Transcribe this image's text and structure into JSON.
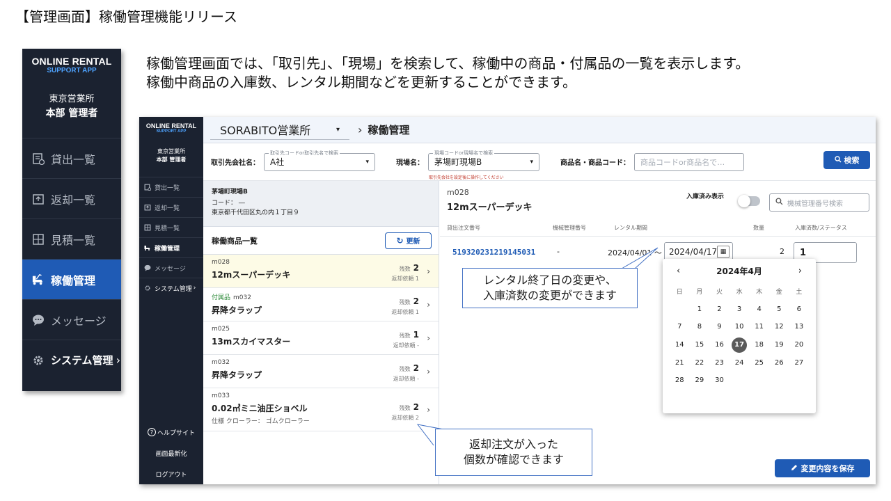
{
  "slide": {
    "title": "【管理画面】稼働管理機能リリース",
    "desc1": "稼働管理画面では、「取引先」、「現場」を検索して、稼働中の商品・付属品の一覧を表示します。",
    "desc2": "稼働中商品の入庫数、レンタル期間などを更新することができます。"
  },
  "big_sidebar": {
    "logo1": "ONLINE RENTAL",
    "logo2": "SUPPORT APP",
    "office": "東京営業所",
    "role": "本部 管理者",
    "items": [
      "貸出一覧",
      "返却一覧",
      "見積一覧",
      "稼働管理",
      "メッセージ",
      "システム管理"
    ]
  },
  "app": {
    "sidebar": {
      "logo1": "ONLINE RENTAL",
      "logo2": "SUPPORT APP",
      "office": "東京営業所",
      "role": "本部 管理者",
      "items": [
        "貸出一覧",
        "返却一覧",
        "見積一覧",
        "稼働管理",
        "メッセージ",
        "システム管理"
      ],
      "help": "ヘルプサイト",
      "refresh": "画面最新化",
      "logout": "ログアウト"
    },
    "topbar": {
      "office": "SORABITO営業所",
      "crumb": "稼働管理"
    },
    "search": {
      "client_label": "取引先会社名：",
      "client_legend": "取引先コードor取引先名で検索",
      "client_value": "A社",
      "site_label": "現場名：",
      "site_legend": "現場コードor現場名で検索",
      "site_value": "茅場町現場B",
      "site_hint": "取引先会社を設定後に操作してください",
      "product_label": "商品名・商品コード：",
      "product_placeholder": "商品コードor商品名で…",
      "button": "検索"
    },
    "site_info": {
      "name": "茅場町現場B",
      "code": "コード：  ―",
      "address": "東京都千代田区丸の内１丁目９"
    },
    "list": {
      "title": "稼働商品一覧",
      "update": "更新",
      "remain_label": "残数",
      "return_label": "返却依頼",
      "items": [
        {
          "tag": "",
          "code": "m028",
          "name": "12mスーパーデッキ",
          "remain": "2",
          "returns": "1",
          "spec": ""
        },
        {
          "tag": "付属品",
          "code": "m032",
          "name": "昇降タラップ",
          "remain": "2",
          "returns": "1",
          "spec": ""
        },
        {
          "tag": "",
          "code": "m025",
          "name": "13mスカイマスター",
          "remain": "1",
          "returns": "-",
          "spec": ""
        },
        {
          "tag": "",
          "code": "m032",
          "name": "昇降タラップ",
          "remain": "2",
          "returns": "-",
          "spec": ""
        },
        {
          "tag": "",
          "code": "m033",
          "name": "0.02㎥ミニ油圧ショベル",
          "remain": "2",
          "returns": "2",
          "spec": "仕様 クローラー：  ゴムクローラー"
        }
      ]
    },
    "detail": {
      "code": "m028",
      "name": "12mスーパーデッキ",
      "toggle_label": "入庫済み表示",
      "mgmt_placeholder": "機械管理番号検索",
      "cols": [
        "貸出注文番号",
        "機械管理番号",
        "レンタル期間",
        "数量",
        "入庫済数/ステータス"
      ],
      "row": {
        "order": "519320231219145031",
        "mgmt": "-",
        "start": "2024/04/01 〜",
        "end": "2024/04/17",
        "qty": "2",
        "received": "1"
      }
    },
    "calendar": {
      "month": "2024年4月",
      "weekdays": [
        "日",
        "月",
        "火",
        "水",
        "木",
        "金",
        "土"
      ],
      "selected": 17,
      "days": [
        null,
        1,
        2,
        3,
        4,
        5,
        6,
        7,
        8,
        9,
        10,
        11,
        12,
        13,
        14,
        15,
        16,
        17,
        18,
        19,
        20,
        21,
        22,
        23,
        24,
        25,
        26,
        27,
        28,
        29,
        30
      ]
    },
    "save": "変更内容を保存"
  },
  "callouts": {
    "c1_line1": "レンタル終了日の変更や、",
    "c1_line2": "入庫済数の変更ができます",
    "c2_line1": "返却注文が入った",
    "c2_line2": "個数が確認できます"
  }
}
